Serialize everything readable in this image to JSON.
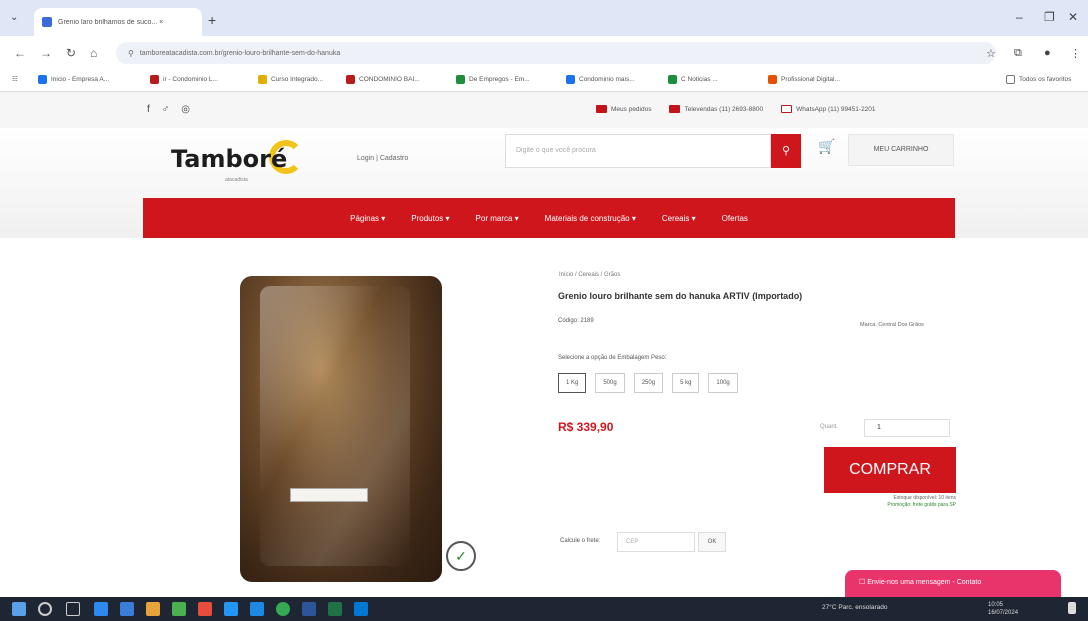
{
  "browser": {
    "tab_title": "Grenio laro brilhamos de suco... ×",
    "url": "tamboreatacadista.com.br/grenio-louro-brilhante-sem-do-hanuka",
    "bookmarks": [
      "Inicio - Empresa A...",
      "ir - Condominio L...",
      "Curso Integrado...",
      "CONDOMINIO BAI...",
      "De Empregos - Em...",
      "Condominio mais...",
      "C Noticias ...",
      "Profissional Digital...",
      "Todos os favoritos"
    ]
  },
  "site": {
    "social": [
      "f",
      "♂",
      "◎"
    ],
    "top_links": [
      "Meus pedidos",
      "Televendas (11) 2693-8800",
      "WhatsApp (11) 99451-2201"
    ],
    "logo_text": "Tamboré",
    "logo_sub": "atacadista",
    "login_text": "Login | Cadastro",
    "search_placeholder": "Digite o que você procura",
    "cart_label": "MEU CARRINHO",
    "nav": [
      "Páginas ▾",
      "Produtos ▾",
      "Por marca ▾",
      "Materiais de construção ▾",
      "Cereais ▾",
      "Ofertas"
    ]
  },
  "product": {
    "breadcrumb": "Início / Cereais / Grãos",
    "title": "Grenio louro brilhante sem do hanuka ARTIV (Importado)",
    "sku": "Código: 2189",
    "brand": "Marca: Central Dos Grãos",
    "option_label": "Selecione a opção de Embalagem Peso:",
    "options": [
      "1 Kg",
      "500g",
      "250g",
      "5 kg",
      "100g"
    ],
    "price": "R$ 339,90",
    "qty_label": "Quant.",
    "qty_value": "1",
    "buy_label": "COMPRAR",
    "buy_note_1": "Estoque disponível: 10 itens",
    "buy_note_2": "Promoção: frete grátis para SP",
    "shipping_label": "Calcule o frete:",
    "cep_placeholder": "CEP",
    "ok_label": "OK",
    "chat_label": "☐ Envie-nos uma mensagem - Contato"
  },
  "taskbar": {
    "tray_text": "27°C Parc. ensolarado",
    "time": "10:05",
    "date": "16/07/2024"
  }
}
